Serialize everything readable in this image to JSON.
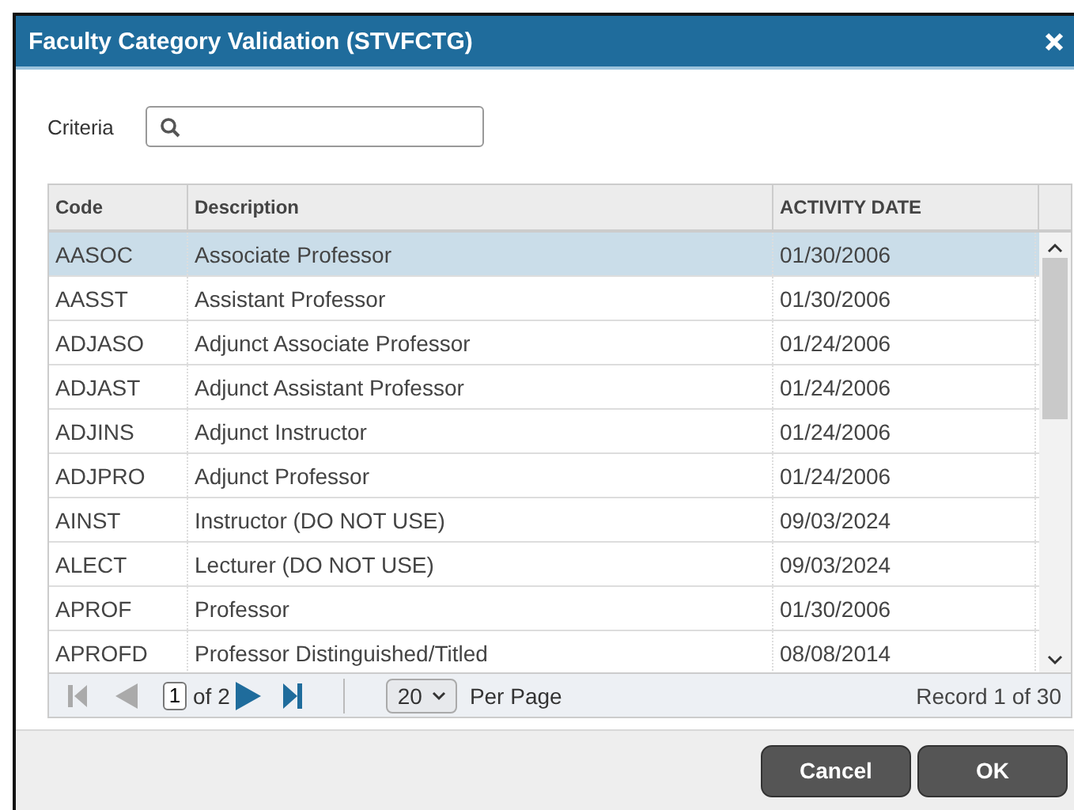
{
  "window": {
    "title": "Faculty Category Validation (STVFCTG)"
  },
  "criteria": {
    "label": "Criteria"
  },
  "table": {
    "columns": [
      "Code",
      "Description",
      "ACTIVITY DATE"
    ],
    "rows": [
      {
        "code": "AASOC",
        "description": "Associate Professor",
        "activity_date": "01/30/2006",
        "selected": true
      },
      {
        "code": "AASST",
        "description": "Assistant Professor",
        "activity_date": "01/30/2006",
        "selected": false
      },
      {
        "code": "ADJASO",
        "description": "Adjunct Associate Professor",
        "activity_date": "01/24/2006",
        "selected": false
      },
      {
        "code": "ADJAST",
        "description": "Adjunct Assistant Professor",
        "activity_date": "01/24/2006",
        "selected": false
      },
      {
        "code": "ADJINS",
        "description": "Adjunct Instructor",
        "activity_date": "01/24/2006",
        "selected": false
      },
      {
        "code": "ADJPRO",
        "description": "Adjunct Professor",
        "activity_date": "01/24/2006",
        "selected": false
      },
      {
        "code": "AINST",
        "description": "Instructor (DO NOT USE)",
        "activity_date": "09/03/2024",
        "selected": false
      },
      {
        "code": "ALECT",
        "description": "Lecturer (DO NOT USE)",
        "activity_date": "09/03/2024",
        "selected": false
      },
      {
        "code": "APROF",
        "description": "Professor",
        "activity_date": "01/30/2006",
        "selected": false
      },
      {
        "code": "APROFD",
        "description": "Professor Distinguished/Titled",
        "activity_date": "08/08/2014",
        "selected": false
      }
    ]
  },
  "pager": {
    "page": "1",
    "of": "of 2",
    "per_page_value": "20",
    "per_page_label": "Per Page",
    "record": "Record 1 of 30"
  },
  "buttons": [
    "Cancel",
    "OK"
  ]
}
